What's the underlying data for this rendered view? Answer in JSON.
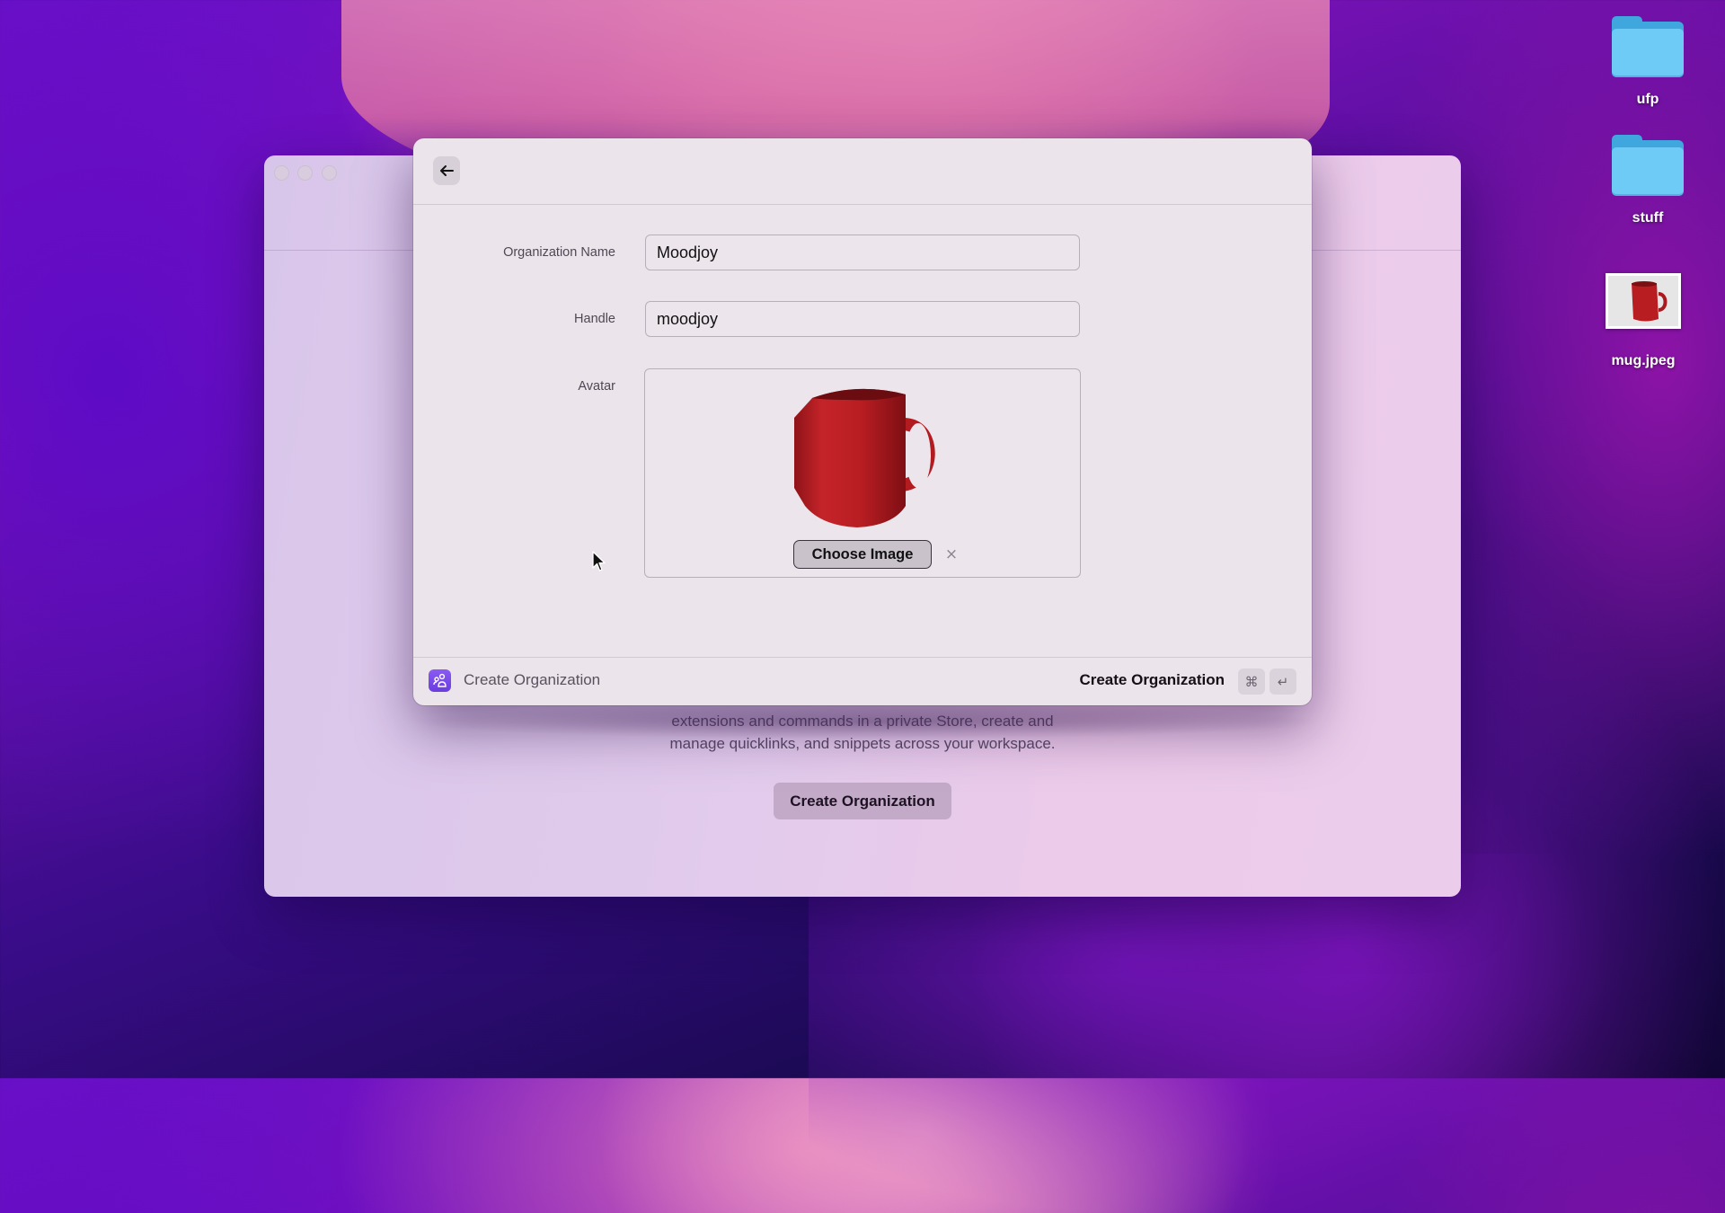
{
  "desktop": {
    "icons": [
      {
        "label": "ufp",
        "type": "folder",
        "icon": "folder-icon"
      },
      {
        "label": "stuff",
        "type": "folder",
        "icon": "folder-icon"
      },
      {
        "label": "mug.jpeg",
        "type": "image-file",
        "icon": "image-thumbnail-icon"
      }
    ]
  },
  "background_window": {
    "description_lines": [
      "extensions and commands in a private Store, create and",
      "manage quicklinks, and snippets across your workspace."
    ],
    "create_button_label": "Create Organization"
  },
  "dialog": {
    "back_icon": "arrow-left-icon",
    "form": {
      "org_name_label": "Organization Name",
      "org_name_value": "Moodjoy",
      "handle_label": "Handle",
      "handle_value": "moodjoy",
      "avatar_label": "Avatar",
      "avatar_image": "red-mug",
      "choose_image_label": "Choose Image",
      "clear_label": "×"
    },
    "footer": {
      "icon": "organization-icon",
      "title": "Create Organization",
      "action_label": "Create Organization",
      "shortcut_keys": [
        "⌘",
        "↵"
      ]
    }
  },
  "colors": {
    "accent": "#7a4cec",
    "dialog_bg": "#ebe4eb",
    "mug_red": "#b81d22"
  }
}
